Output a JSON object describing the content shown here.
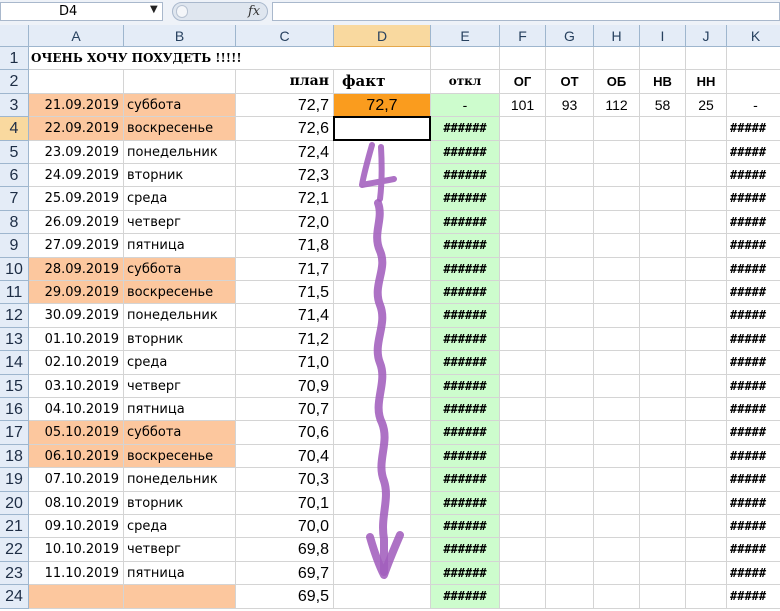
{
  "name_box": "D4",
  "formula_label": "fx",
  "formula_value": "",
  "columns": [
    "A",
    "B",
    "C",
    "D",
    "E",
    "F",
    "G",
    "H",
    "I",
    "J",
    "K"
  ],
  "selected_col": "D",
  "selected_row": "4",
  "title": "ОЧЕНЬ ХОЧУ ПОХУДЕТЬ !!!!!",
  "headers": {
    "plan": "план",
    "fakt": "факт",
    "otkl": "откл",
    "og": "ОГ",
    "ot": "ОТ",
    "ob": "ОБ",
    "nv": "НВ",
    "nn": "НН"
  },
  "row3_measurements": {
    "fakt": "72,7",
    "otkl": "-",
    "og": "101",
    "ot": "93",
    "ob": "112",
    "nv": "58",
    "nn": "25",
    "k": "-"
  },
  "error_e": "######",
  "error_k": "#####",
  "annotation_text": "4",
  "rows": [
    {
      "num": "3",
      "date": "21.09.2019",
      "day": "суббота",
      "plan": "72,7",
      "weekend": true
    },
    {
      "num": "4",
      "date": "22.09.2019",
      "day": "воскресенье",
      "plan": "72,6",
      "weekend": true
    },
    {
      "num": "5",
      "date": "23.09.2019",
      "day": "понедельник",
      "plan": "72,4",
      "weekend": false
    },
    {
      "num": "6",
      "date": "24.09.2019",
      "day": "вторник",
      "plan": "72,3",
      "weekend": false
    },
    {
      "num": "7",
      "date": "25.09.2019",
      "day": "среда",
      "plan": "72,1",
      "weekend": false
    },
    {
      "num": "8",
      "date": "26.09.2019",
      "day": "четверг",
      "plan": "72,0",
      "weekend": false
    },
    {
      "num": "9",
      "date": "27.09.2019",
      "day": "пятница",
      "plan": "71,8",
      "weekend": false
    },
    {
      "num": "10",
      "date": "28.09.2019",
      "day": "суббота",
      "plan": "71,7",
      "weekend": true
    },
    {
      "num": "11",
      "date": "29.09.2019",
      "day": "воскресенье",
      "plan": "71,5",
      "weekend": true
    },
    {
      "num": "12",
      "date": "30.09.2019",
      "day": "понедельник",
      "plan": "71,4",
      "weekend": false
    },
    {
      "num": "13",
      "date": "01.10.2019",
      "day": "вторник",
      "plan": "71,2",
      "weekend": false
    },
    {
      "num": "14",
      "date": "02.10.2019",
      "day": "среда",
      "plan": "71,0",
      "weekend": false
    },
    {
      "num": "15",
      "date": "03.10.2019",
      "day": "четверг",
      "plan": "70,9",
      "weekend": false
    },
    {
      "num": "16",
      "date": "04.10.2019",
      "day": "пятница",
      "plan": "70,7",
      "weekend": false
    },
    {
      "num": "17",
      "date": "05.10.2019",
      "day": "суббота",
      "plan": "70,6",
      "weekend": true
    },
    {
      "num": "18",
      "date": "06.10.2019",
      "day": "воскресенье",
      "plan": "70,4",
      "weekend": true
    },
    {
      "num": "19",
      "date": "07.10.2019",
      "day": "понедельник",
      "plan": "70,3",
      "weekend": false
    },
    {
      "num": "20",
      "date": "08.10.2019",
      "day": "вторник",
      "plan": "70,1",
      "weekend": false
    },
    {
      "num": "21",
      "date": "09.10.2019",
      "day": "среда",
      "plan": "70,0",
      "weekend": false
    },
    {
      "num": "22",
      "date": "10.10.2019",
      "day": "четверг",
      "plan": "69,8",
      "weekend": false
    },
    {
      "num": "23",
      "date": "11.10.2019",
      "day": "пятница",
      "plan": "69,7",
      "weekend": false
    },
    {
      "num": "24",
      "date": "",
      "day": "",
      "plan": "69,5",
      "weekend": true
    }
  ],
  "colors": {
    "weekend_fill": "#fcc79e",
    "fakt_fill": "#fa9c1e",
    "otkl_fill": "#cdfccd",
    "arrow": "#a25ebd",
    "header_bg": "#e4ecf7",
    "selected_header": "#f9d99f",
    "gridline": "#d4d4d4"
  }
}
